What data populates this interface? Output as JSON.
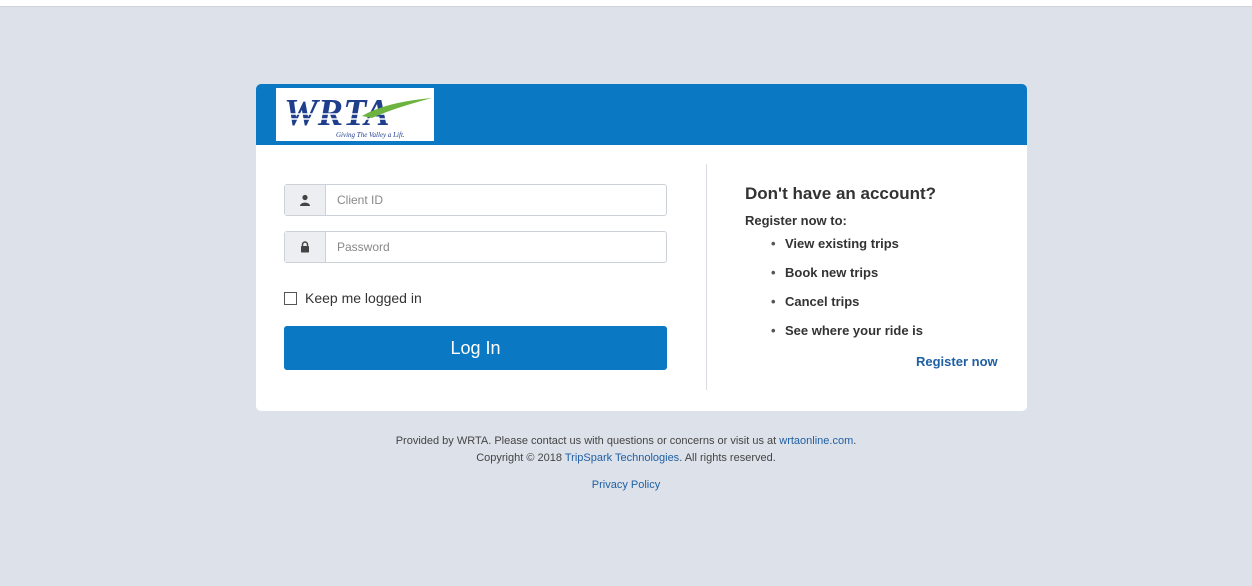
{
  "brand": {
    "logo_text": "WRTA",
    "logo_tagline": "Giving The Valley a Lift.",
    "accent_color": "#0a78c2",
    "link_color": "#1f5fa3"
  },
  "login": {
    "client_id_placeholder": "Client ID",
    "password_placeholder": "Password",
    "client_id_icon": "user-icon",
    "password_icon": "lock-icon",
    "keep_logged_in_label": "Keep me logged in",
    "keep_logged_in_checked": false,
    "login_button_label": "Log In"
  },
  "register": {
    "heading": "Don't have an account?",
    "subheading": "Register now to:",
    "items": [
      "View existing trips",
      "Book new trips",
      "Cancel trips",
      "See where your ride is"
    ],
    "link_label": "Register now"
  },
  "footer": {
    "line1_prefix": "Provided by WRTA. Please contact us with questions or concerns or visit us at ",
    "line1_link": "wrtaonline.com",
    "line1_suffix": ".",
    "line2_prefix": "Copyright © 2018 ",
    "line2_link": "TripSpark Technologies",
    "line2_suffix": ". All rights reserved.",
    "privacy_label": "Privacy Policy"
  }
}
